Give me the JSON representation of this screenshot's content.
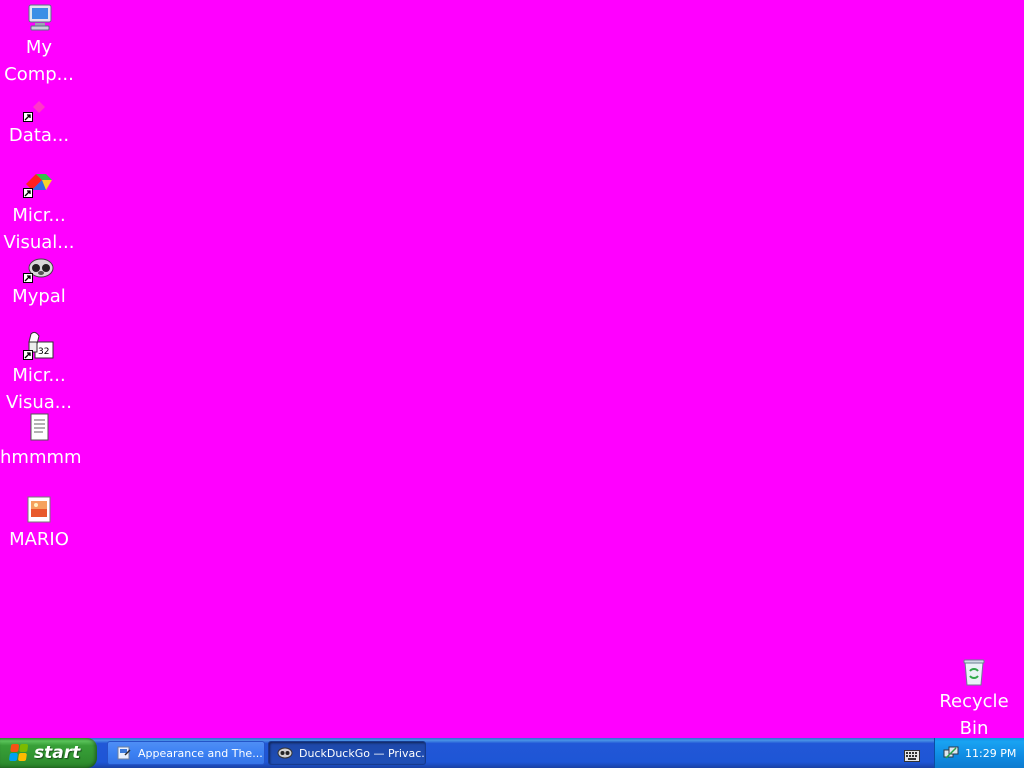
{
  "desktop": {
    "background_color": "#ff00ff",
    "icons": [
      {
        "label": "My\nComp...",
        "icon": "my-computer-icon"
      },
      {
        "label": "Data...",
        "icon": "data-shortcut-icon"
      },
      {
        "label": "Micr...\nVisual...",
        "icon": "ms-visual-studio-icon"
      },
      {
        "label": "Mypal",
        "icon": "mypal-browser-icon"
      },
      {
        "label": "Micr...\nVisua...",
        "icon": "ms-visual-tool-icon"
      },
      {
        "label": "hmmmm",
        "icon": "text-document-icon"
      },
      {
        "label": "MARIO",
        "icon": "image-file-icon"
      },
      {
        "label": "Recycle\nBin",
        "icon": "recycle-bin-icon"
      }
    ]
  },
  "taskbar": {
    "start_label": "start",
    "tasks": [
      {
        "label": "Appearance and The...",
        "icon": "control-panel-icon",
        "active": false
      },
      {
        "label": "DuckDuckGo — Privac...",
        "icon": "mypal-browser-icon",
        "active": true
      }
    ],
    "tray": {
      "clock": "11:29 PM",
      "icons": [
        "keyboard-icon",
        "network-icon"
      ]
    },
    "colors": {
      "taskbar_blue": "#245edb",
      "start_green": "#3c9b3c",
      "tray_blue": "#0f8be3"
    }
  }
}
